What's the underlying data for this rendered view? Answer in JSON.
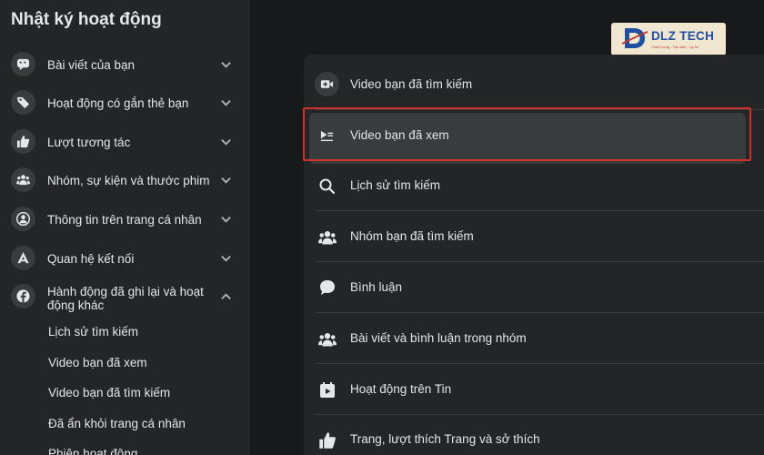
{
  "sidebar": {
    "title": "Nhật ký hoạt động",
    "items": [
      {
        "label": "Bài viết của bạn",
        "icon": "message-icon"
      },
      {
        "label": "Hoạt động có gắn thẻ bạn",
        "icon": "tag-icon"
      },
      {
        "label": "Lượt tương tác",
        "icon": "thumbs-up-icon"
      },
      {
        "label": "Nhóm, sự kiện và thước phim",
        "icon": "people-icon"
      },
      {
        "label": "Thông tin trên trang cá nhân",
        "icon": "profile-icon"
      },
      {
        "label": "Quan hệ kết nối",
        "icon": "connection-icon"
      },
      {
        "label_line1": "Hành động đã ghi lại và hoạt",
        "label_line2": "động khác",
        "icon": "facebook-icon",
        "expanded": true
      }
    ],
    "sub_items": [
      "Lịch sử tìm kiếm",
      "Video bạn đã xem",
      "Video bạn đã tìm kiếm",
      "Đã ẩn khỏi trang cá nhân",
      "Phiên hoạt động"
    ]
  },
  "logo": {
    "text": "DLZ TECH",
    "tagline": "Chất lượng - Tận tâm - Uy tín"
  },
  "list": {
    "rows": [
      {
        "label": "Video bạn đã tìm kiếm",
        "icon": "video-add-icon"
      },
      {
        "label": "Video bạn đã xem",
        "icon": "watch-list-icon",
        "active": true
      },
      {
        "label": "Lịch sử tìm kiếm",
        "icon": "search-icon"
      },
      {
        "label": "Nhóm bạn đã tìm kiếm",
        "icon": "people-icon"
      },
      {
        "label": "Bình luận",
        "icon": "comment-icon"
      },
      {
        "label": "Bài viết và bình luận trong nhóm",
        "icon": "people-icon"
      },
      {
        "label": "Hoạt động trên Tin",
        "icon": "story-icon"
      },
      {
        "label": "Trang, lượt thích Trang và sở thích",
        "icon": "thumbs-up-icon"
      }
    ]
  },
  "colors": {
    "background": "#18191a",
    "panel": "#242526",
    "icon_bg": "#3a3b3c",
    "text": "#e4e6eb",
    "highlight": "#d0312d",
    "brand": "#1f4fa1"
  }
}
